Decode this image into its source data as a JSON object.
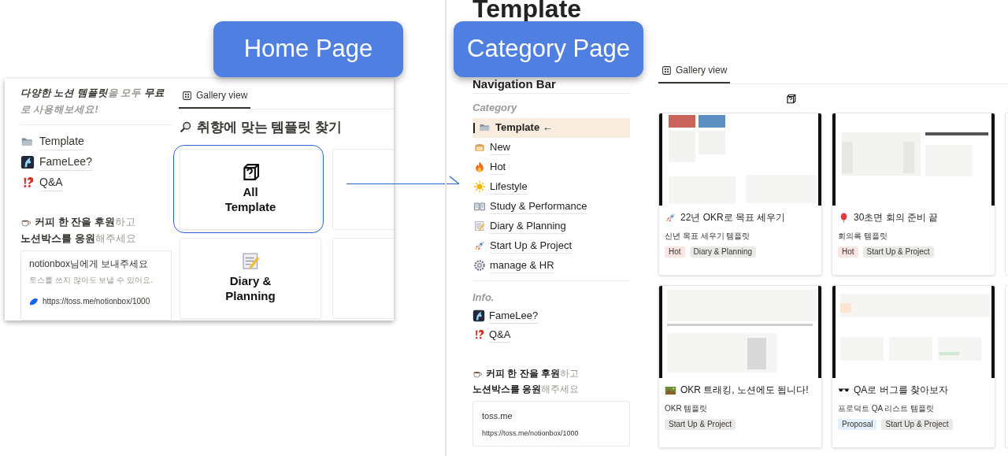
{
  "home_page": {
    "label": "Home Page",
    "intro": "**다양한 노션 템플릿**을 모두 **무료**로 사용해보세요!",
    "links": [
      "Template",
      "FameLee?",
      "Q&A"
    ],
    "support": [
      "**커피 한 잔을 후원**하고",
      "**노션박스를 응원**해주세요"
    ],
    "toss_card": {
      "title": "notionbox님에게 보내주세요",
      "note": "토스를 쓰지 않아도 보낼 수 있어요.",
      "url": "https://toss.me/notionbox/1000"
    },
    "tab": {
      "label": "Gallery view",
      "selected": true
    },
    "heading": "취향에 맞는 템플릿 찾기",
    "cards": [
      {
        "title": "All\nTemplate",
        "highlighted": true
      },
      {
        "title": "Diary &\nPlanning",
        "highlighted": false
      }
    ]
  },
  "category_page": {
    "label": "Category Page",
    "heading": "Template",
    "subheading": "Navigation Bar",
    "sidebar": {
      "category_title": "Category",
      "items": [
        {
          "label": "Template ←",
          "selected": true
        },
        {
          "label": "New",
          "selected": false
        },
        {
          "label": "Hot",
          "selected": false
        },
        {
          "label": "Lifestyle",
          "selected": false
        },
        {
          "label": "Study & Performance",
          "selected": false
        },
        {
          "label": "Diary & Planning",
          "selected": false
        },
        {
          "label": "Start Up & Project",
          "selected": false
        },
        {
          "label": "manage & HR",
          "selected": false
        }
      ],
      "info_title": "Info.",
      "info_items": [
        "FameLee?",
        "Q&A"
      ],
      "support": [
        "**커피 한 잔을 후원**하고",
        "**노션박스를 응원**해주세요"
      ],
      "toss_card": {
        "title": "toss.me",
        "url": "https://toss.me/notionbox/1000"
      }
    },
    "tab": {
      "label": "Gallery view",
      "selected": true
    },
    "cards": [
      {
        "title": "22년 OKR로 목표 세우기",
        "subtitle": "신년 목표 세우기 템플릿",
        "tags": [
          {
            "label": "Hot",
            "color": "#fbe4e4"
          },
          {
            "label": "Diary & Planning",
            "color": "#e9e9e7"
          }
        ]
      },
      {
        "title": "30초면 회의 준비 끝",
        "subtitle": "회의록 템플릿",
        "tags": [
          {
            "label": "Hot",
            "color": "#fbe4e4"
          },
          {
            "label": "Start Up & Project",
            "color": "#e9e9e7"
          }
        ]
      },
      {
        "title": "OKR 트래킹, 노션에도 됩니다!",
        "subtitle": "OKR 템플릿",
        "tags": [
          {
            "label": "Start Up & Project",
            "color": "#e9e9e7"
          }
        ]
      },
      {
        "title": "QA로 버그를 찾아보자",
        "subtitle": "프로덕트 QA 리스트 템플릿",
        "tags": [
          {
            "label": "Proposal",
            "color": "#e3f0fb"
          },
          {
            "label": "Start Up & Project",
            "color": "#e9e9e7"
          }
        ]
      }
    ]
  }
}
